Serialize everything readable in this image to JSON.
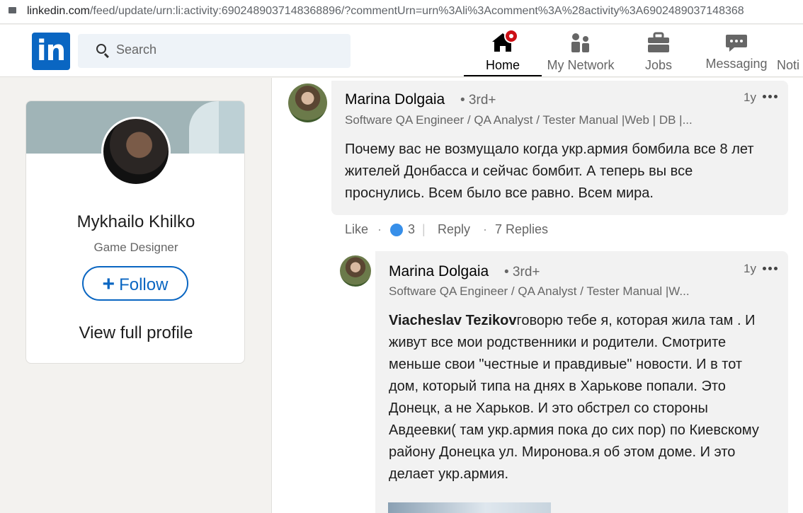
{
  "browser": {
    "url_domain": "linkedin.com",
    "url_path": "/feed/update/urn:li:activity:6902489037148368896/?commentUrn=urn%3Ali%3Acomment%3A%28activity%3A6902489037148368"
  },
  "nav": {
    "logo": "in",
    "search_placeholder": "Search",
    "items": [
      {
        "label": "Home"
      },
      {
        "label": "My Network"
      },
      {
        "label": "Jobs"
      },
      {
        "label": "Messaging"
      },
      {
        "label": "Noti"
      }
    ]
  },
  "profile": {
    "name": "Mykhailo Khilko",
    "title": "Game Designer",
    "follow_label": "Follow",
    "view_profile": "View full profile"
  },
  "comments": [
    {
      "author": "Marina Dolgaia",
      "degree": "• 3rd+",
      "headline": "Software QA Engineer / QA Analyst / Tester Manual |Web | DB |...",
      "time": "1y",
      "text": "Почему вас не возмущало когда укр.армия бомбила все 8 лет жителей Донбасса и сейчас бомбит. А теперь вы все проснулись. Всем было все равно. Всем мира.",
      "like_label": "Like",
      "like_count": "3",
      "reply_label": "Reply",
      "replies_label": "7 Replies"
    },
    {
      "author": "Marina Dolgaia",
      "degree": "• 3rd+",
      "headline": "Software QA Engineer / QA Analyst / Tester Manual |W...",
      "time": "1y",
      "mention": "Viacheslav Tezikov",
      "text": "говорю тебе я, которая жила там . И живут все мои родственники и родители. Смотрите меньше свои \"честные и правдивые\" новости. И в тот дом, который типа на днях в Харькове попали. Это Донецк, а не Харьков. И это обстрел со стороны Авдеевки( там укр.армия пока до сих пор) по Киевскому району Донецка ул. Миронова.я об этом доме. И это делает укр.армия."
    }
  ],
  "colors": {
    "brand": "#0a66c2",
    "notification_badge": "#cc1016",
    "like_reaction": "#378fe9"
  }
}
